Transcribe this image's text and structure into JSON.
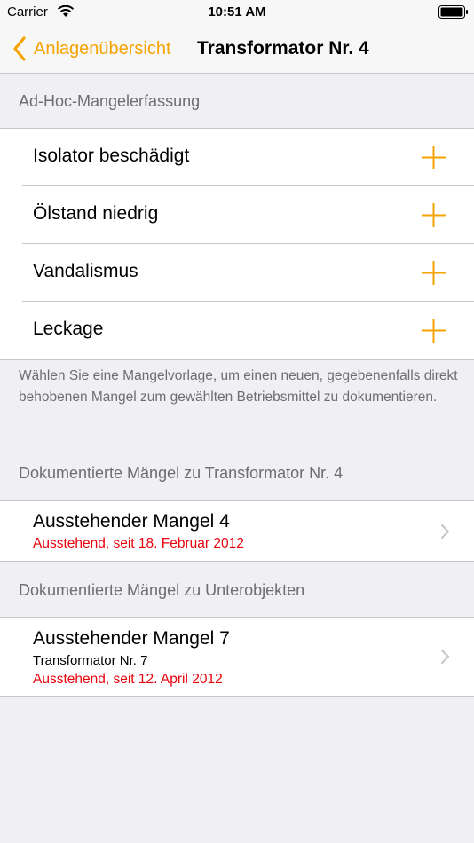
{
  "status_bar": {
    "carrier": "Carrier",
    "time": "10:51 AM"
  },
  "nav": {
    "back_label": "Anlagenübersicht",
    "title": "Transformator Nr. 4"
  },
  "adhoc": {
    "header": "Ad-Hoc-Mangelerfassung",
    "items": [
      {
        "label": "Isolator beschädigt"
      },
      {
        "label": "Ölstand niedrig"
      },
      {
        "label": "Vandalismus"
      },
      {
        "label": "Leckage"
      }
    ],
    "footer": "Wählen Sie eine Mangelvorlage, um einen neuen, gegebenenfalls direkt behobenen Mangel zum gewählten Betriebsmittel zu dokumentieren."
  },
  "documented": {
    "header": "Dokumentierte Mängel zu Transformator Nr. 4",
    "items": [
      {
        "title": "Ausstehender Mangel 4",
        "status": "Ausstehend, seit 18. Februar 2012"
      }
    ]
  },
  "subobjects": {
    "header": "Dokumentierte Mängel zu Unterobjekten",
    "items": [
      {
        "title": "Ausstehender Mangel 7",
        "subtitle": "Transformator Nr. 7",
        "status": "Ausstehend, seit 12. April 2012"
      }
    ]
  },
  "colors": {
    "accent": "#f5a300",
    "status_red": "#e8000a",
    "background": "#efeff4",
    "header_gray": "#6d6d72"
  },
  "icons": [
    "wifi-icon",
    "battery-icon",
    "chevron-left-icon",
    "plus-icon",
    "chevron-right-icon"
  ]
}
